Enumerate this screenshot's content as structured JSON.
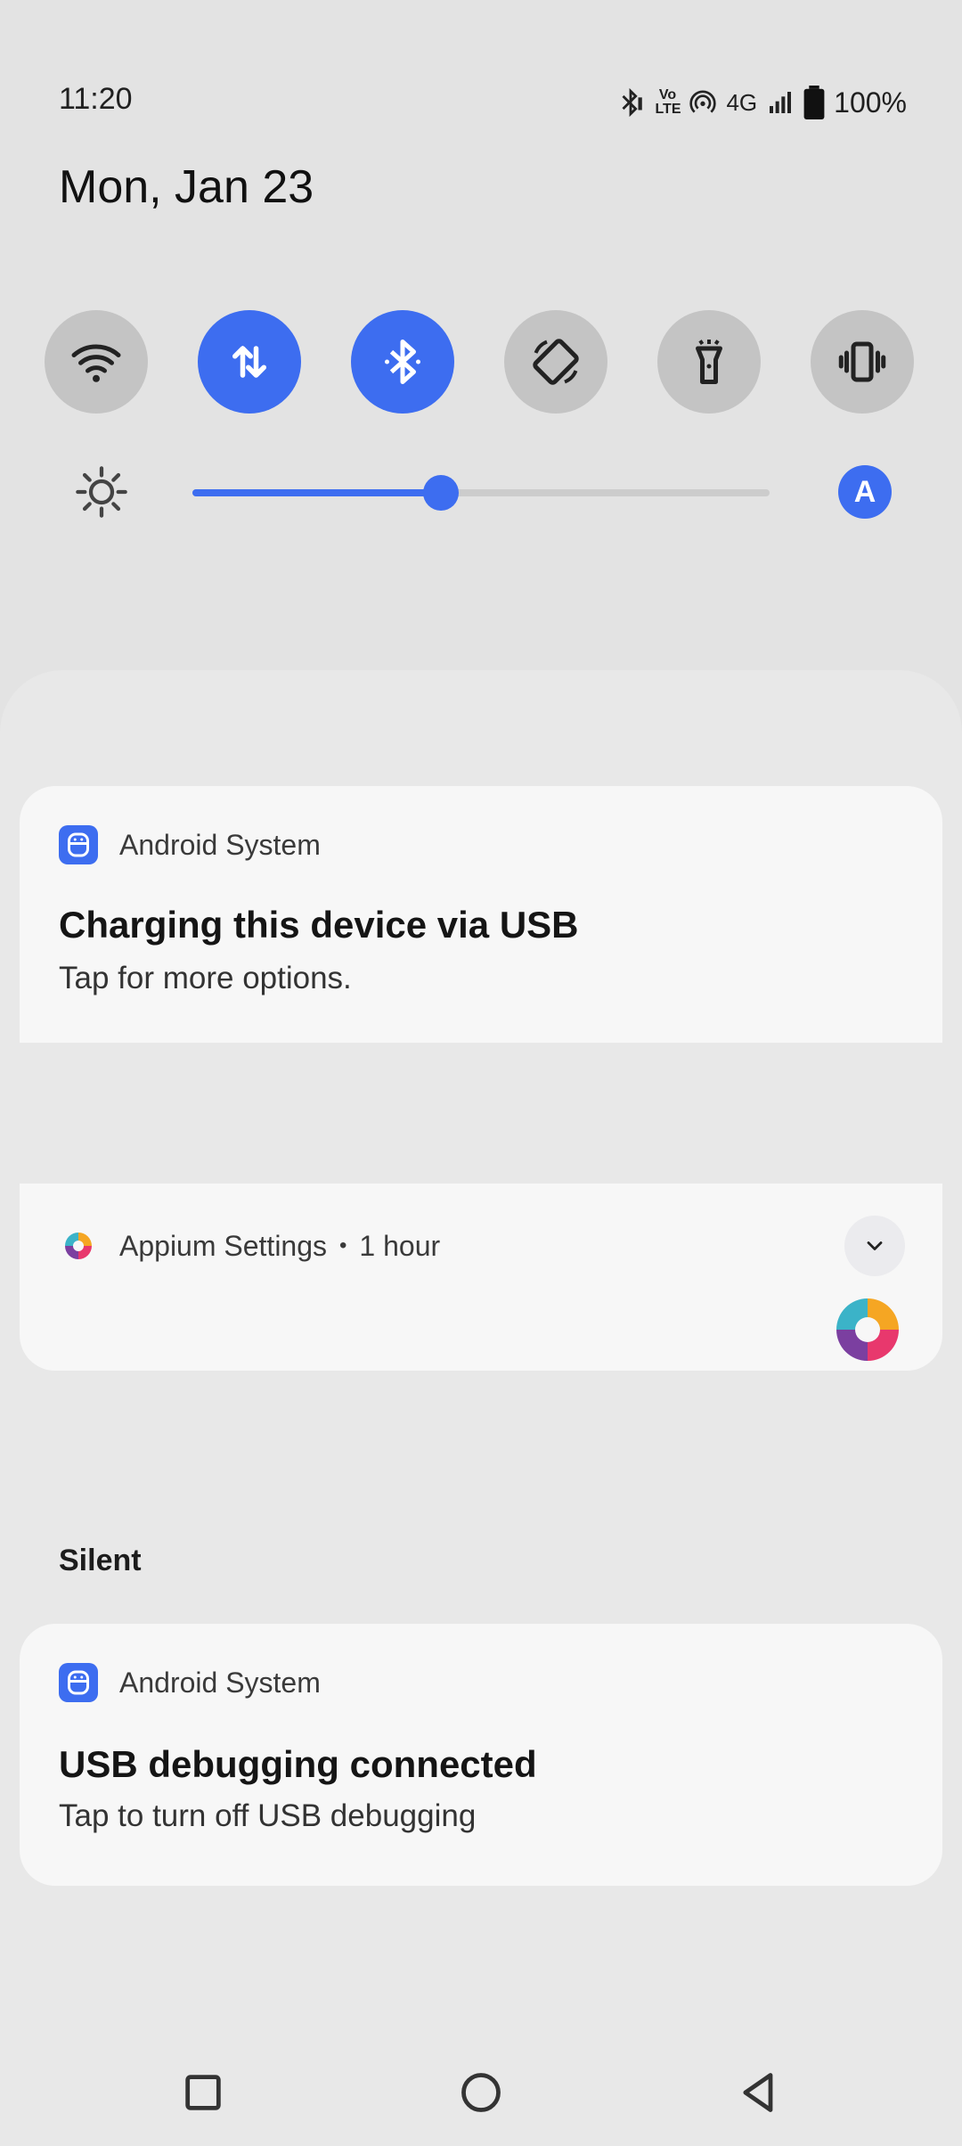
{
  "status_bar": {
    "time": "11:20",
    "volte_label": "Vo LTE",
    "network_label": "4G",
    "battery": "100%"
  },
  "date": "Mon, Jan 23",
  "quick_settings": {
    "tiles": [
      {
        "name": "wifi-icon",
        "state": "off"
      },
      {
        "name": "mobile-data-icon",
        "state": "on"
      },
      {
        "name": "bluetooth-icon",
        "state": "on"
      },
      {
        "name": "auto-rotate-icon",
        "state": "off"
      },
      {
        "name": "flashlight-icon",
        "state": "off"
      },
      {
        "name": "vibrate-icon",
        "state": "off"
      }
    ],
    "brightness_level": 0.43,
    "auto_brightness_label": "A"
  },
  "notifications": {
    "usb_charging": {
      "app": "Android System",
      "title": "Charging this device via USB",
      "text": "Tap for more options."
    },
    "appium": {
      "app": "Appium Settings",
      "separator": "•",
      "time": "1 hour"
    },
    "silent_section_label": "Silent",
    "usb_debugging": {
      "app": "Android System",
      "title": "USB debugging connected",
      "text": "Tap to turn off USB debugging"
    }
  },
  "colors": {
    "accent": "#3d6df0",
    "tile_off": "#c4c4c4",
    "background": "#e3e3e3"
  }
}
